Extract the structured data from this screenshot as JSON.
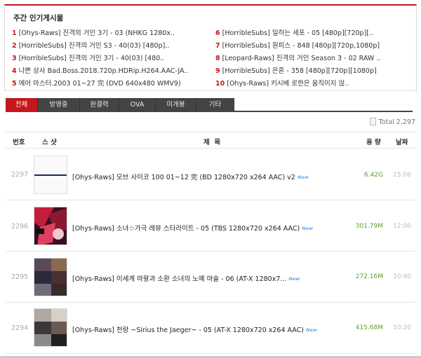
{
  "popular": {
    "title": "주간 인기게시물",
    "left": [
      {
        "rank": "1",
        "text": "[Ohys-Raws] 진격의 거인 3기 - 03 (NHKG 1280x.."
      },
      {
        "rank": "2",
        "text": "[HorribleSubs] 진격의 거인 S3 - 40(03) [480p].."
      },
      {
        "rank": "3",
        "text": "[HorribleSubs] 진격의 거인 3기 - 40(03) [480.."
      },
      {
        "rank": "4",
        "text": "나쁜 상사 Bad.Boss.2018.720p.HDRip.H264.AAC-JA.."
      },
      {
        "rank": "5",
        "text": "에어 마스터.2003 01~27 完 (DVD 640x480 WMV9)"
      }
    ],
    "right": [
      {
        "rank": "6",
        "text": "[HorribleSubs] 일하는 세포 - 05 [480p][720p][.."
      },
      {
        "rank": "7",
        "text": "[HorribleSubs] 원피스 - 848 [480p][720p,1080p]"
      },
      {
        "rank": "8",
        "text": "[Leopard-Raws] 진격의 거인 Season 3 - 02 RAW .."
      },
      {
        "rank": "9",
        "text": "[HorribleSubs] 은혼 - 358 [480p][720p][1080p]"
      },
      {
        "rank": "10",
        "text": "[Ohys-Raws] 키시베 로한은 움직이지 않.."
      }
    ]
  },
  "tabs": [
    "전체",
    "방영중",
    "완결력",
    "OVA",
    "미개봉",
    "기타"
  ],
  "total": "Total 2,297",
  "table": {
    "headers": {
      "num": "번호",
      "thumb": "스 샷",
      "title": "제  목",
      "size": "용 량",
      "date": "날짜"
    },
    "rows": [
      {
        "num": "2297",
        "title": "[Ohys-Raws] 모브 사이코 100 01~12 完 (BD 1280x720 x264 AAC) v2",
        "new": "New",
        "size": "6.42G",
        "time": "15:00"
      },
      {
        "num": "2296",
        "title": "[Ohys-Raws] 소녀☆가극 레뷰 스타라이트 - 05 (TBS 1280x720 x264 AAC)",
        "new": "New",
        "size": "301.79M",
        "time": "12:00"
      },
      {
        "num": "2295",
        "title": "[Ohys-Raws] 이세계 마왕과 소환 소녀의 노예 마술 - 06 (AT-X 1280x7...",
        "new": "New",
        "size": "272.16M",
        "time": "10:40"
      },
      {
        "num": "2294",
        "title": "[Ohys-Raws] 천랑 ~Sirius the Jaeger~ - 05 (AT-X 1280x720 x264 AAC)",
        "new": "New",
        "size": "415.68M",
        "time": "10:20"
      }
    ]
  },
  "colors": {
    "accent": "#c4161c",
    "tab_bg": "#444444",
    "size_green": "#5aa02c",
    "new_blue": "#6aa9e9"
  }
}
